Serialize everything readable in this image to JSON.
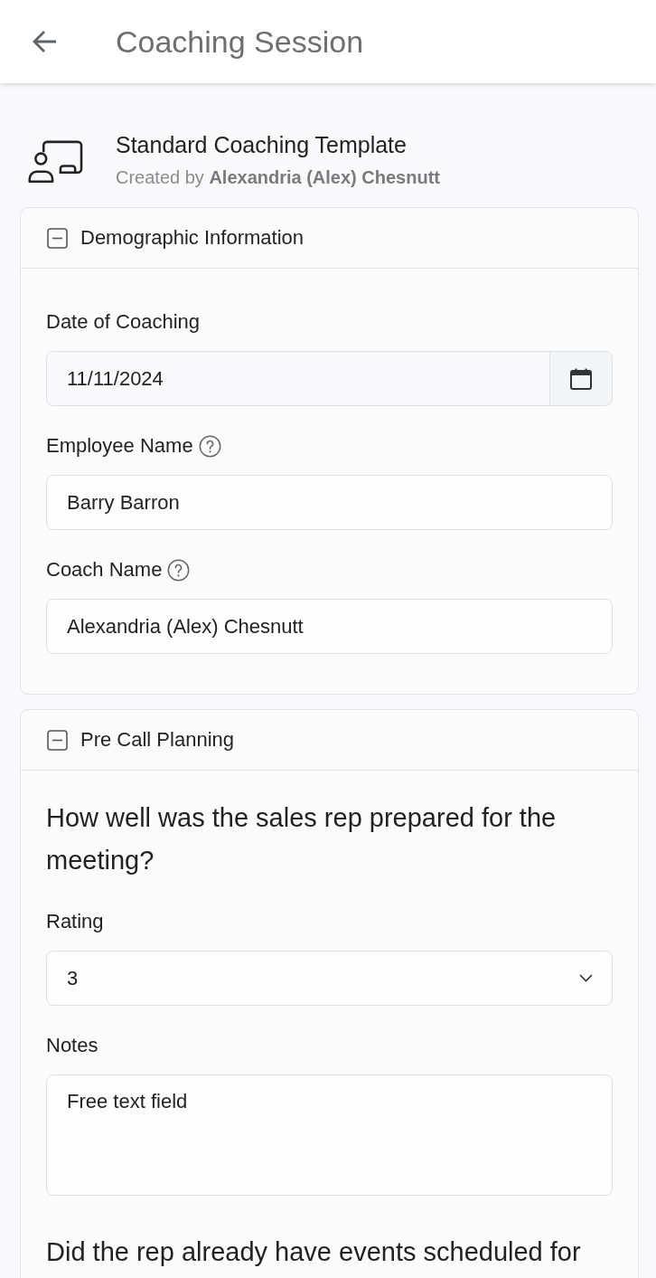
{
  "header": {
    "title": "Coaching Session"
  },
  "template": {
    "title": "Standard Coaching Template",
    "created_by": "Created by **Alexandria (Alex) Chesnutt**"
  },
  "sections": [
    {
      "title": "Demographic Information",
      "expanded": true,
      "items": [
        {
          "kind": "date",
          "label": "Date of Coaching",
          "help": false,
          "value": "11/11/2024"
        },
        {
          "kind": "text",
          "label": "Employee Name",
          "help": true,
          "value": "Barry Barron"
        },
        {
          "kind": "text",
          "label": "Coach Name",
          "help": true,
          "value": "Alexandria (Alex) Chesnutt"
        }
      ]
    },
    {
      "title": "Pre Call Planning",
      "expanded": true,
      "items": [
        {
          "kind": "question",
          "text": "How well was the sales rep prepared for the meeting?"
        },
        {
          "kind": "select",
          "label": "Rating",
          "help": false,
          "value": "3"
        },
        {
          "kind": "textarea",
          "label": "Notes",
          "help": false,
          "value": "Free text field"
        },
        {
          "kind": "question",
          "text": "Did the rep already have events scheduled for"
        }
      ]
    }
  ]
}
